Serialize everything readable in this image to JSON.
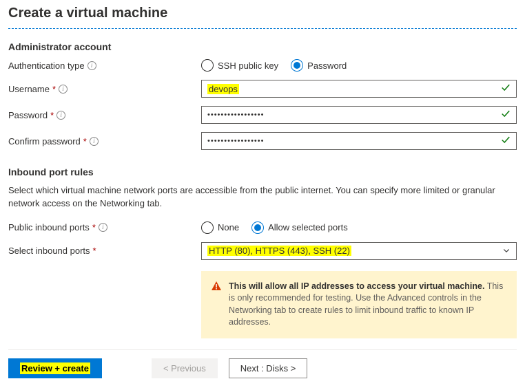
{
  "header": {
    "page_title": "Create a virtual machine"
  },
  "admin": {
    "section_title": "Administrator account",
    "auth_label": "Authentication type",
    "auth_ssh": "SSH public key",
    "auth_password": "Password",
    "username_label": "Username",
    "username_value": "devops",
    "password_label": "Password",
    "password_value": "•••••••••••••••••",
    "confirm_label": "Confirm password",
    "confirm_value": "•••••••••••••••••"
  },
  "inbound": {
    "section_title": "Inbound port rules",
    "description": "Select which virtual machine network ports are accessible from the public internet. You can specify more limited or granular network access on the Networking tab.",
    "public_label": "Public inbound ports",
    "opt_none": "None",
    "opt_allow": "Allow selected ports",
    "select_label": "Select inbound ports",
    "select_value": "HTTP (80), HTTPS (443), SSH (22)",
    "warning_bold": "This will allow all IP addresses to access your virtual machine.",
    "warning_text": "This is only recommended for testing.  Use the Advanced controls in the Networking tab to create rules to limit inbound traffic to known IP addresses."
  },
  "footer": {
    "review": "Review + create",
    "previous": "< Previous",
    "next": "Next : Disks >"
  }
}
